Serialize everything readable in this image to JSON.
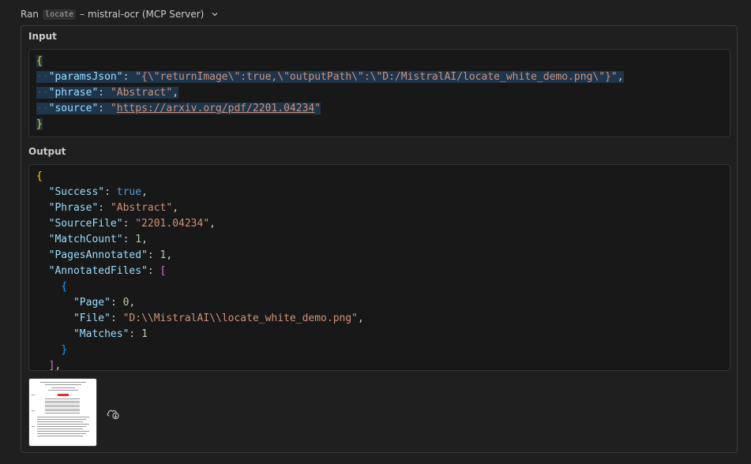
{
  "header": {
    "ran_label": "Ran",
    "tool_name": "locate",
    "server_label": "– mistral-ocr (MCP Server)"
  },
  "input_section": {
    "label": "Input",
    "lines": [
      {
        "parts": [
          [
            "br1",
            "{"
          ]
        ]
      },
      {
        "parts": [
          [
            "ws",
            "··"
          ],
          [
            "k",
            "\"paramsJson\""
          ],
          [
            "p",
            ": "
          ],
          [
            "s",
            "\"{\\\"returnImage\\\":true,\\\"outputPath\\\":\\\"D:/MistralAI/locate_white_demo.png\\\"}\""
          ],
          [
            "p",
            ","
          ]
        ]
      },
      {
        "parts": [
          [
            "ws",
            "··"
          ],
          [
            "k",
            "\"phrase\""
          ],
          [
            "p",
            ": "
          ],
          [
            "s",
            "\"Abstract\""
          ],
          [
            "p",
            ","
          ]
        ]
      },
      {
        "parts": [
          [
            "ws",
            "··"
          ],
          [
            "k",
            "\"source\""
          ],
          [
            "p",
            ": "
          ],
          [
            "s",
            "\""
          ],
          [
            "su",
            "https://arxiv.org/pdf/2201.04234"
          ],
          [
            "s",
            "\""
          ]
        ]
      },
      {
        "parts": [
          [
            "br1",
            "}"
          ]
        ]
      }
    ]
  },
  "output_section": {
    "label": "Output",
    "lines": [
      {
        "parts": [
          [
            "br1",
            "{"
          ]
        ]
      },
      {
        "parts": [
          [
            "p",
            "  "
          ],
          [
            "k",
            "\"Success\""
          ],
          [
            "p",
            ": "
          ],
          [
            "b",
            "true"
          ],
          [
            "p",
            ","
          ]
        ]
      },
      {
        "parts": [
          [
            "p",
            "  "
          ],
          [
            "k",
            "\"Phrase\""
          ],
          [
            "p",
            ": "
          ],
          [
            "s",
            "\"Abstract\""
          ],
          [
            "p",
            ","
          ]
        ]
      },
      {
        "parts": [
          [
            "p",
            "  "
          ],
          [
            "k",
            "\"SourceFile\""
          ],
          [
            "p",
            ": "
          ],
          [
            "s",
            "\"2201.04234\""
          ],
          [
            "p",
            ","
          ]
        ]
      },
      {
        "parts": [
          [
            "p",
            "  "
          ],
          [
            "k",
            "\"MatchCount\""
          ],
          [
            "p",
            ": "
          ],
          [
            "n",
            "1"
          ],
          [
            "p",
            ","
          ]
        ]
      },
      {
        "parts": [
          [
            "p",
            "  "
          ],
          [
            "k",
            "\"PagesAnnotated\""
          ],
          [
            "p",
            ": "
          ],
          [
            "n",
            "1"
          ],
          [
            "p",
            ","
          ]
        ]
      },
      {
        "parts": [
          [
            "p",
            "  "
          ],
          [
            "k",
            "\"AnnotatedFiles\""
          ],
          [
            "p",
            ": "
          ],
          [
            "br2",
            "["
          ]
        ]
      },
      {
        "parts": [
          [
            "p",
            "    "
          ],
          [
            "br3",
            "{"
          ]
        ]
      },
      {
        "parts": [
          [
            "p",
            "      "
          ],
          [
            "k",
            "\"Page\""
          ],
          [
            "p",
            ": "
          ],
          [
            "n",
            "0"
          ],
          [
            "p",
            ","
          ]
        ]
      },
      {
        "parts": [
          [
            "p",
            "      "
          ],
          [
            "k",
            "\"File\""
          ],
          [
            "p",
            ": "
          ],
          [
            "s",
            "\"D:\\\\MistralAI\\\\locate_white_demo.png\""
          ],
          [
            "p",
            ","
          ]
        ]
      },
      {
        "parts": [
          [
            "p",
            "      "
          ],
          [
            "k",
            "\"Matches\""
          ],
          [
            "p",
            ": "
          ],
          [
            "n",
            "1"
          ]
        ]
      },
      {
        "parts": [
          [
            "p",
            "    "
          ],
          [
            "br3",
            "}"
          ]
        ]
      },
      {
        "parts": [
          [
            "p",
            "  "
          ],
          [
            "br2",
            "]"
          ],
          [
            "p",
            ","
          ]
        ]
      }
    ]
  },
  "thumbnail": {
    "alt": "annotated page preview"
  },
  "icons": {
    "chevron": "chevron-down-icon",
    "cloud": "cloud-download-icon"
  }
}
